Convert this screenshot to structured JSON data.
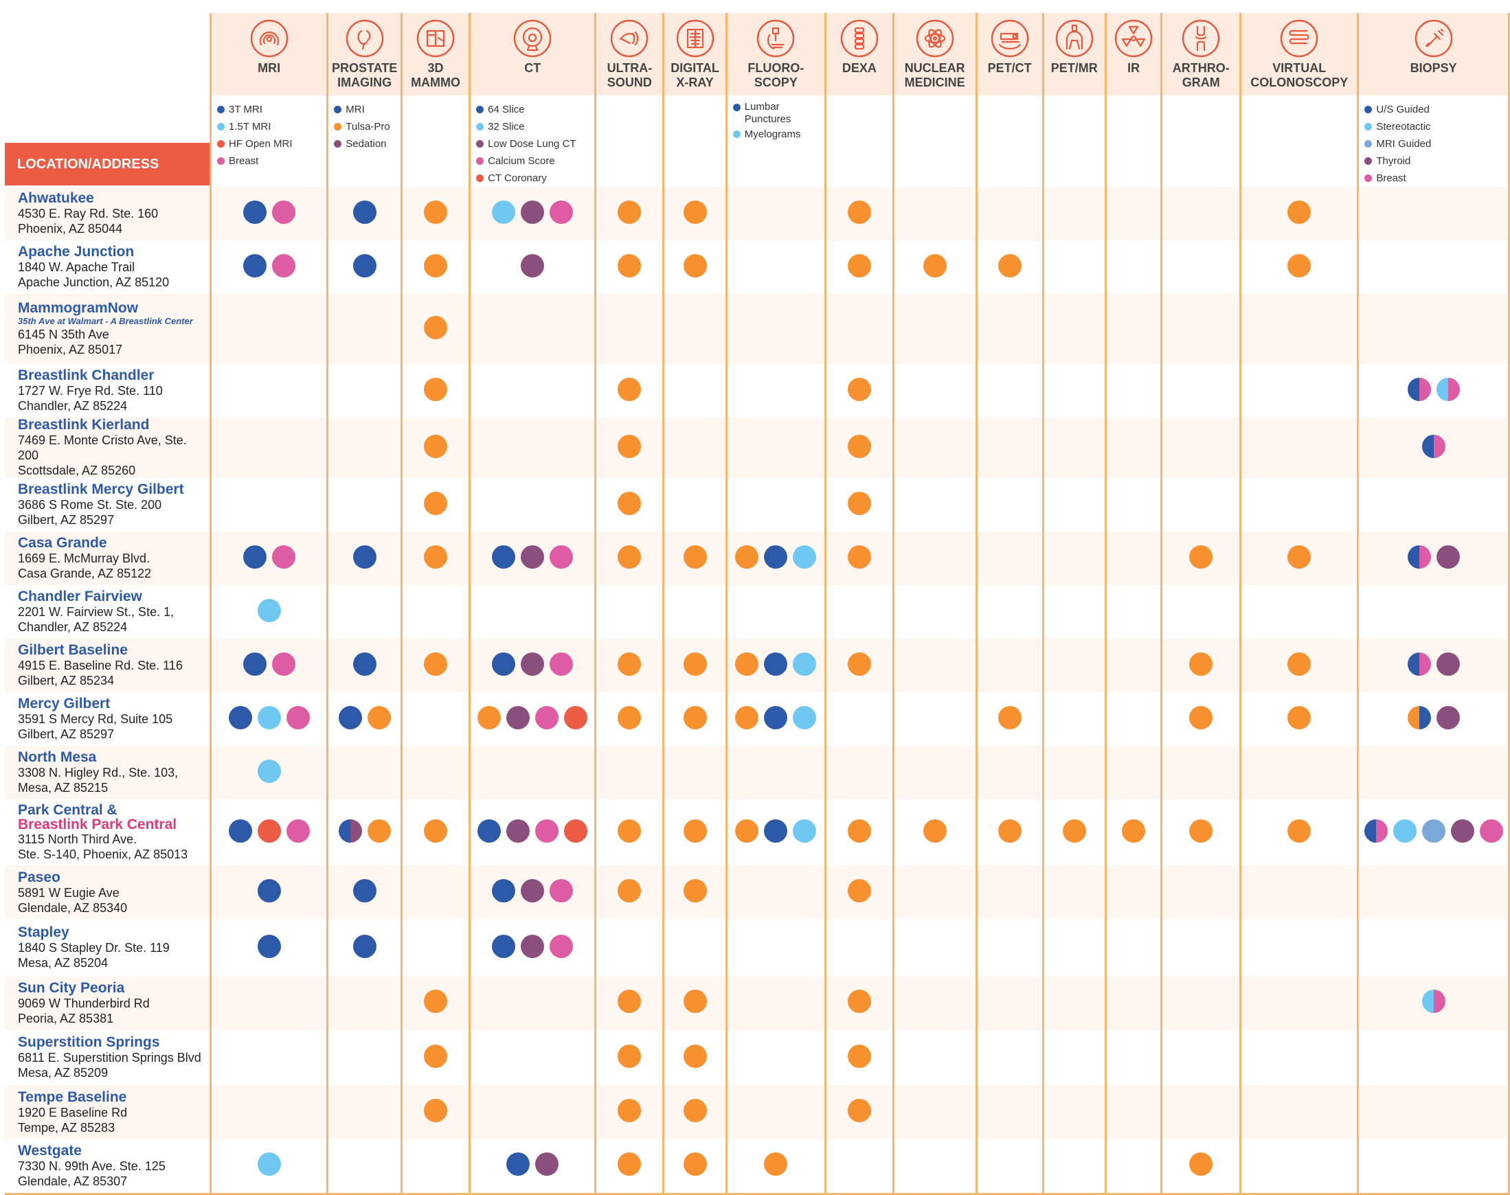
{
  "colors": {
    "dark_blue": "#2d5aa8",
    "light_blue": "#6fc8f2",
    "red": "#ec5b43",
    "pink": "#dd5ca4",
    "orange": "#f7912f",
    "purple": "#8a4f7d",
    "mid_blue": "#7aa9d9",
    "header_bg": "#fdebe0",
    "grid_line": "#f8b56c",
    "location_blue": "#2d5aa8",
    "breastlink_pink": "#e0377e"
  },
  "location_header": "LOCATION/ADDRESS",
  "columns": [
    {
      "id": "mri",
      "label": [
        "MRI"
      ],
      "icon": "mri-scanner-icon",
      "legend": [
        {
          "label": "3T MRI",
          "color": "#2d5aa8"
        },
        {
          "label": "1.5T MRI",
          "color": "#6fc8f2"
        },
        {
          "label": "HF Open MRI",
          "color": "#ec5b43"
        },
        {
          "label": "Breast",
          "color": "#dd5ca4"
        }
      ]
    },
    {
      "id": "prostate",
      "label": [
        "PROSTATE",
        "IMAGING"
      ],
      "icon": "prostate-icon",
      "legend": [
        {
          "label": "MRI",
          "color": "#2d5aa8"
        },
        {
          "label": "Tulsa-Pro",
          "color": "#f7912f"
        },
        {
          "label": "Sedation",
          "color": "#8a4f7d"
        }
      ]
    },
    {
      "id": "mammo",
      "label": [
        "3D",
        "MAMMO"
      ],
      "icon": "mammography-icon",
      "legend": []
    },
    {
      "id": "ct",
      "label": [
        "CT"
      ],
      "icon": "ct-scanner-icon",
      "legend": [
        {
          "label": "64 Slice",
          "color": "#2d5aa8"
        },
        {
          "label": "32 Slice",
          "color": "#6fc8f2"
        },
        {
          "label": "Low Dose Lung CT",
          "color": "#8a4f7d"
        },
        {
          "label": "Calcium Score",
          "color": "#dd5ca4"
        },
        {
          "label": "CT Coronary",
          "color": "#ec5b43"
        }
      ]
    },
    {
      "id": "ultrasound",
      "label": [
        "ULTRA-",
        "SOUND"
      ],
      "icon": "ultrasound-probe-icon",
      "legend": []
    },
    {
      "id": "xray",
      "label": [
        "DIGITAL",
        "X-RAY"
      ],
      "icon": "xray-spine-icon",
      "legend": []
    },
    {
      "id": "fluoro",
      "label": [
        "FLUORO-",
        "SCOPY"
      ],
      "icon": "fluoroscopy-c-arm-icon",
      "legend": [
        {
          "label": "Lumbar Punctures",
          "color": "#2d5aa8",
          "two": true
        },
        {
          "label": "Myelograms",
          "color": "#6fc8f2"
        }
      ]
    },
    {
      "id": "dexa",
      "label": [
        "DEXA"
      ],
      "icon": "spine-vertebrae-icon",
      "legend": []
    },
    {
      "id": "nuclear",
      "label": [
        "NUCLEAR",
        "MEDICINE"
      ],
      "icon": "atom-icon",
      "legend": []
    },
    {
      "id": "petct",
      "label": [
        "PET/CT"
      ],
      "icon": "pet-ct-bed-icon",
      "legend": []
    },
    {
      "id": "petmr",
      "label": [
        "PET/MR"
      ],
      "icon": "pet-mr-scanner-icon",
      "legend": []
    },
    {
      "id": "ir",
      "label": [
        "IR"
      ],
      "icon": "radiation-icon",
      "legend": []
    },
    {
      "id": "arthro",
      "label": [
        "ARTHRO-",
        "GRAM"
      ],
      "icon": "joint-icon",
      "legend": []
    },
    {
      "id": "colon",
      "label": [
        "VIRTUAL",
        "COLONOSCOPY"
      ],
      "icon": "intestine-icon",
      "legend": []
    },
    {
      "id": "biopsy",
      "label": [
        "BIOPSY"
      ],
      "icon": "syringe-icon",
      "legend": [
        {
          "label": "U/S Guided",
          "color": "#2d5aa8"
        },
        {
          "label": "Stereotactic",
          "color": "#6fc8f2"
        },
        {
          "label": "MRI Guided",
          "color": "#7aa9d9"
        },
        {
          "label": "Thyroid",
          "color": "#8a4f7d"
        },
        {
          "label": "Breast",
          "color": "#dd5ca4"
        }
      ]
    }
  ],
  "locations": [
    {
      "name": "Ahwatukee",
      "address": [
        "4530 E. Ray Rd. Ste. 160",
        "Phoenix, AZ 85044"
      ],
      "cells": {
        "mri": [
          "#2d5aa8",
          "#dd5ca4"
        ],
        "prostate": [
          "#2d5aa8"
        ],
        "mammo": [
          "#f7912f"
        ],
        "ct": [
          "#6fc8f2",
          "#8a4f7d",
          "#dd5ca4"
        ],
        "ultrasound": [
          "#f7912f"
        ],
        "xray": [
          "#f7912f"
        ],
        "dexa": [
          "#f7912f"
        ],
        "colon": [
          "#f7912f"
        ]
      }
    },
    {
      "name": "Apache Junction",
      "address": [
        "1840 W. Apache Trail",
        "Apache Junction, AZ 85120"
      ],
      "cells": {
        "mri": [
          "#2d5aa8",
          "#dd5ca4"
        ],
        "prostate": [
          "#2d5aa8"
        ],
        "mammo": [
          "#f7912f"
        ],
        "ct": [
          "#8a4f7d"
        ],
        "ultrasound": [
          "#f7912f"
        ],
        "xray": [
          "#f7912f"
        ],
        "dexa": [
          "#f7912f"
        ],
        "nuclear": [
          "#f7912f"
        ],
        "petct": [
          "#f7912f"
        ],
        "colon": [
          "#f7912f"
        ]
      }
    },
    {
      "name": "MammogramNow",
      "subtitle": "35th Ave at Walmart - A Breastlink Center",
      "address": [
        "6145 N 35th Ave",
        "Phoenix, AZ 85017"
      ],
      "cells": {
        "mammo": [
          "#f7912f"
        ]
      }
    },
    {
      "name": "Breastlink Chandler",
      "address": [
        "1727 W. Frye Rd. Ste. 110",
        "Chandler, AZ 85224"
      ],
      "cells": {
        "mammo": [
          "#f7912f"
        ],
        "ultrasound": [
          "#f7912f"
        ],
        "dexa": [
          "#f7912f"
        ],
        "biopsy": [
          [
            "#2d5aa8",
            "#dd5ca4"
          ],
          [
            "#6fc8f2",
            "#dd5ca4"
          ]
        ]
      }
    },
    {
      "name": "Breastlink Kierland",
      "address": [
        "7469 E. Monte Cristo Ave, Ste. 200",
        "Scottsdale, AZ 85260"
      ],
      "cells": {
        "mammo": [
          "#f7912f"
        ],
        "ultrasound": [
          "#f7912f"
        ],
        "dexa": [
          "#f7912f"
        ],
        "biopsy": [
          [
            "#2d5aa8",
            "#dd5ca4"
          ]
        ]
      }
    },
    {
      "name": "Breastlink Mercy Gilbert",
      "address": [
        "3686 S Rome St. Ste. 200",
        "Gilbert, AZ 85297"
      ],
      "cells": {
        "mammo": [
          "#f7912f"
        ],
        "ultrasound": [
          "#f7912f"
        ],
        "dexa": [
          "#f7912f"
        ]
      }
    },
    {
      "name": "Casa Grande",
      "address": [
        "1669 E. McMurray Blvd.",
        "Casa Grande, AZ 85122"
      ],
      "cells": {
        "mri": [
          "#2d5aa8",
          "#dd5ca4"
        ],
        "prostate": [
          "#2d5aa8"
        ],
        "mammo": [
          "#f7912f"
        ],
        "ct": [
          "#2d5aa8",
          "#8a4f7d",
          "#dd5ca4"
        ],
        "ultrasound": [
          "#f7912f"
        ],
        "xray": [
          "#f7912f"
        ],
        "fluoro": [
          "#f7912f",
          "#2d5aa8",
          "#6fc8f2"
        ],
        "dexa": [
          "#f7912f"
        ],
        "arthro": [
          "#f7912f"
        ],
        "colon": [
          "#f7912f"
        ],
        "biopsy": [
          [
            "#2d5aa8",
            "#dd5ca4"
          ],
          "#8a4f7d"
        ]
      }
    },
    {
      "name": "Chandler Fairview",
      "address": [
        "2201 W. Fairview St., Ste. 1,",
        "Chandler, AZ 85224"
      ],
      "cells": {
        "mri": [
          "#6fc8f2"
        ]
      }
    },
    {
      "name": "Gilbert Baseline",
      "address": [
        "4915 E. Baseline Rd. Ste. 116",
        "Gilbert, AZ 85234"
      ],
      "cells": {
        "mri": [
          "#2d5aa8",
          "#dd5ca4"
        ],
        "prostate": [
          "#2d5aa8"
        ],
        "mammo": [
          "#f7912f"
        ],
        "ct": [
          "#2d5aa8",
          "#8a4f7d",
          "#dd5ca4"
        ],
        "ultrasound": [
          "#f7912f"
        ],
        "xray": [
          "#f7912f"
        ],
        "fluoro": [
          "#f7912f",
          "#2d5aa8",
          "#6fc8f2"
        ],
        "dexa": [
          "#f7912f"
        ],
        "arthro": [
          "#f7912f"
        ],
        "colon": [
          "#f7912f"
        ],
        "biopsy": [
          [
            "#2d5aa8",
            "#dd5ca4"
          ],
          "#8a4f7d"
        ]
      }
    },
    {
      "name": "Mercy Gilbert",
      "address": [
        "3591 S Mercy Rd, Suite 105",
        "Gilbert, AZ 85297"
      ],
      "cells": {
        "mri": [
          "#2d5aa8",
          "#6fc8f2",
          "#dd5ca4"
        ],
        "prostate": [
          "#2d5aa8",
          "#f7912f"
        ],
        "ct": [
          "#f7912f",
          "#8a4f7d",
          "#dd5ca4",
          "#ec5b43"
        ],
        "ultrasound": [
          "#f7912f"
        ],
        "xray": [
          "#f7912f"
        ],
        "fluoro": [
          "#f7912f",
          "#2d5aa8",
          "#6fc8f2"
        ],
        "petct": [
          "#f7912f"
        ],
        "arthro": [
          "#f7912f"
        ],
        "colon": [
          "#f7912f"
        ],
        "biopsy": [
          [
            "#f7912f",
            "#2d5aa8"
          ],
          "#8a4f7d"
        ]
      }
    },
    {
      "name": "North Mesa",
      "address": [
        "3308 N. Higley Rd., Ste. 103,",
        "Mesa, AZ 85215"
      ],
      "cells": {
        "mri": [
          "#6fc8f2"
        ]
      }
    },
    {
      "name": "Park Central &",
      "name2": "Breastlink Park Central",
      "address": [
        "3115 North Third Ave.",
        "Ste. S-140, Phoenix, AZ 85013"
      ],
      "cells": {
        "mri": [
          "#2d5aa8",
          "#ec5b43",
          "#dd5ca4"
        ],
        "prostate": [
          [
            "#2d5aa8",
            "#8a4f7d"
          ],
          "#f7912f"
        ],
        "mammo": [
          "#f7912f"
        ],
        "ct": [
          "#2d5aa8",
          "#8a4f7d",
          "#dd5ca4",
          "#ec5b43"
        ],
        "ultrasound": [
          "#f7912f"
        ],
        "xray": [
          "#f7912f"
        ],
        "fluoro": [
          "#f7912f",
          "#2d5aa8",
          "#6fc8f2"
        ],
        "dexa": [
          "#f7912f"
        ],
        "nuclear": [
          "#f7912f"
        ],
        "petct": [
          "#f7912f"
        ],
        "petmr": [
          "#f7912f"
        ],
        "ir": [
          "#f7912f"
        ],
        "arthro": [
          "#f7912f"
        ],
        "colon": [
          "#f7912f"
        ],
        "biopsy": [
          [
            "#2d5aa8",
            "#dd5ca4"
          ],
          "#6fc8f2",
          "#7aa9d9",
          "#8a4f7d",
          "#dd5ca4"
        ]
      }
    },
    {
      "name": "Paseo",
      "address": [
        "5891 W Eugie Ave",
        "Glendale, AZ 85340"
      ],
      "cells": {
        "mri": [
          "#2d5aa8"
        ],
        "prostate": [
          "#2d5aa8"
        ],
        "ct": [
          "#2d5aa8",
          "#8a4f7d",
          "#dd5ca4"
        ],
        "ultrasound": [
          "#f7912f"
        ],
        "xray": [
          "#f7912f"
        ],
        "dexa": [
          "#f7912f"
        ]
      }
    },
    {
      "name": "Stapley",
      "address": [
        "1840 S Stapley Dr. Ste. 119",
        "Mesa, AZ 85204"
      ],
      "cells": {
        "mri": [
          "#2d5aa8"
        ],
        "prostate": [
          "#2d5aa8"
        ],
        "ct": [
          "#2d5aa8",
          "#8a4f7d",
          "#dd5ca4"
        ]
      }
    },
    {
      "name": "Sun City Peoria",
      "address": [
        "9069 W Thunderbird Rd",
        "Peoria, AZ 85381"
      ],
      "cells": {
        "mammo": [
          "#f7912f"
        ],
        "ultrasound": [
          "#f7912f"
        ],
        "xray": [
          "#f7912f"
        ],
        "dexa": [
          "#f7912f"
        ],
        "biopsy": [
          [
            "#6fc8f2",
            "#dd5ca4"
          ]
        ]
      }
    },
    {
      "name": "Superstition Springs",
      "address": [
        "6811 E. Superstition Springs Blvd",
        "Mesa, AZ 85209"
      ],
      "cells": {
        "mammo": [
          "#f7912f"
        ],
        "ultrasound": [
          "#f7912f"
        ],
        "xray": [
          "#f7912f"
        ],
        "dexa": [
          "#f7912f"
        ]
      }
    },
    {
      "name": "Tempe Baseline",
      "address": [
        "1920 E Baseline Rd",
        "Tempe, AZ 85283"
      ],
      "cells": {
        "mammo": [
          "#f7912f"
        ],
        "ultrasound": [
          "#f7912f"
        ],
        "xray": [
          "#f7912f"
        ],
        "dexa": [
          "#f7912f"
        ]
      }
    },
    {
      "name": "Westgate",
      "address": [
        "7330 N. 99th Ave. Ste. 125",
        "Glendale, AZ 85307"
      ],
      "cells": {
        "mri": [
          "#6fc8f2"
        ],
        "ct": [
          "#2d5aa8",
          "#8a4f7d"
        ],
        "ultrasound": [
          "#f7912f"
        ],
        "xray": [
          "#f7912f"
        ],
        "fluoro": [
          "#f7912f"
        ],
        "arthro": [
          "#f7912f"
        ]
      }
    }
  ]
}
